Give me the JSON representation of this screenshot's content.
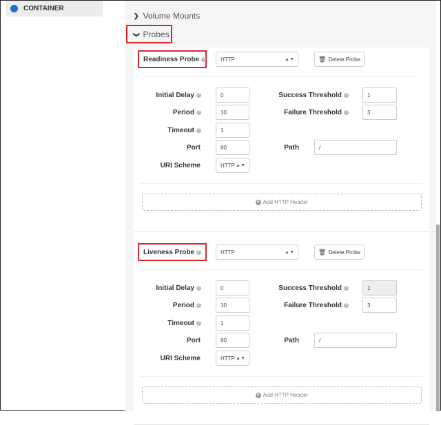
{
  "sidebar": {
    "item_label": "CONTAINER",
    "accent": "#1a73c5"
  },
  "accordion": {
    "volume_mounts": "Volume Mounts",
    "probes": "Probes"
  },
  "probes": [
    {
      "title": "Readiness Probe",
      "type": "HTTP",
      "delete_label": "Delete Probe",
      "initial_delay_label": "Initial Delay",
      "initial_delay": "0",
      "period_label": "Period",
      "period": "10",
      "timeout_label": "Timeout",
      "timeout": "1",
      "port_label": "Port",
      "port": "80",
      "uri_scheme_label": "URI Scheme",
      "uri_scheme": "HTTP",
      "success_threshold_label": "Success Threshold",
      "success_threshold": "1",
      "failure_threshold_label": "Failure Threshold",
      "failure_threshold": "3",
      "path_label": "Path",
      "path": "/",
      "add_header_label": "Add HTTP Header"
    },
    {
      "title": "Liveness Probe",
      "type": "HTTP",
      "delete_label": "Delete Probe",
      "initial_delay_label": "Initial Delay",
      "initial_delay": "0",
      "period_label": "Period",
      "period": "10",
      "timeout_label": "Timeout",
      "timeout": "1",
      "port_label": "Port",
      "port": "80",
      "uri_scheme_label": "URI Scheme",
      "uri_scheme": "HTTP",
      "success_threshold_label": "Success Threshold",
      "success_threshold": "1",
      "failure_threshold_label": "Failure Threshold",
      "failure_threshold": "3",
      "path_label": "Path",
      "path": "/",
      "add_header_label": "Add HTTP Header"
    }
  ],
  "highlight_color": "#d9272e"
}
